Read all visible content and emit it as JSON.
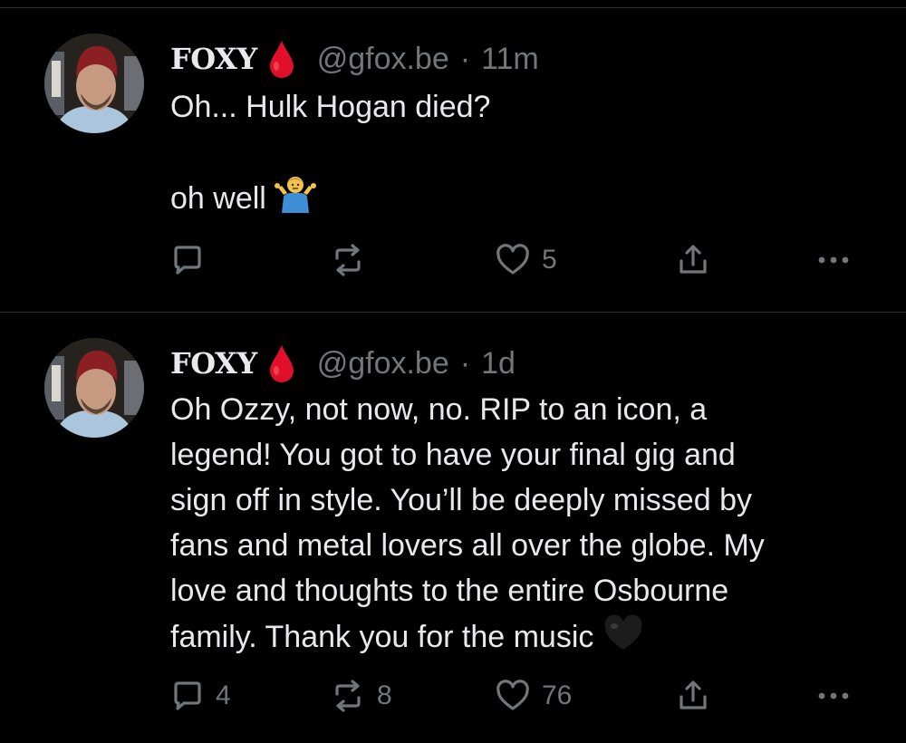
{
  "colors": {
    "background": "#000000",
    "text_primary": "#e7e9ea",
    "text_secondary": "#71767b",
    "divider": "#2f3336",
    "blood_drop": "#e0102a"
  },
  "posts": [
    {
      "author": {
        "display_name": "FOXY",
        "badge_icon": "blood-drop-icon",
        "handle": "@gfox.be",
        "separator": "·",
        "time": "11m"
      },
      "text": "Oh... Hulk Hogan died?\n\noh well",
      "trailing_emoji": "person-shrugging-emoji",
      "actions": {
        "reply_count": "",
        "repost_count": "",
        "like_count": "5"
      }
    },
    {
      "author": {
        "display_name": "FOXY",
        "badge_icon": "blood-drop-icon",
        "handle": "@gfox.be",
        "separator": "·",
        "time": "1d"
      },
      "text": "Oh Ozzy, not now, no. RIP to an icon, a\nlegend! You got to have your final gig and\nsign off in style. You’ll be deeply missed by\nfans and metal lovers all over the globe. My\nlove and thoughts to the entire Osbourne\nfamily. Thank you for the music",
      "trailing_emoji": "black-heart-emoji",
      "actions": {
        "reply_count": "4",
        "repost_count": "8",
        "like_count": "76"
      }
    }
  ]
}
